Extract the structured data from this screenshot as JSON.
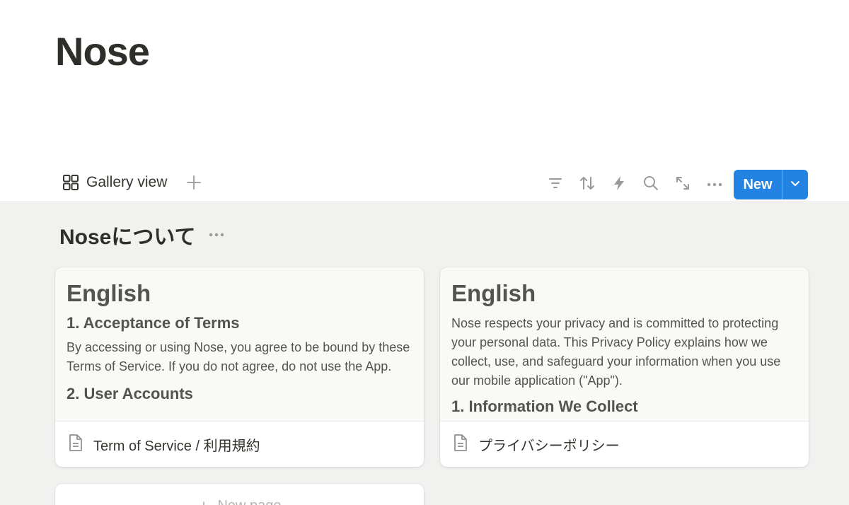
{
  "page": {
    "title": "Nose"
  },
  "toolbar": {
    "view_label": "Gallery view",
    "icons": [
      "gallery-icon",
      "plus-icon",
      "filter-icon",
      "sort-icon",
      "automation-icon",
      "search-icon",
      "expand-icon",
      "more-icon",
      "chevron-down-icon"
    ],
    "new_label": "New",
    "accent": "#2383e2"
  },
  "group": {
    "title": "Noseについて"
  },
  "cards": [
    {
      "preview_heading": "English",
      "preview_subheading": "1. Acceptance of Terms",
      "preview_text": "By accessing or using Nose, you agree to be bound by these Terms of Service. If you do not agree, do not use the App.",
      "preview_subheading2": "2. User Accounts",
      "name": "Term of Service / 利用規約"
    },
    {
      "preview_heading": "English",
      "preview_text": "Nose respects your privacy and is committed to protecting your personal data. This Privacy Policy explains how we collect, use, and safeguard your information when you use our mobile application (\"App\").",
      "preview_subheading": "1. Information We Collect",
      "name": "プライバシーポリシー"
    }
  ],
  "new_page": {
    "label": "New page"
  },
  "colors": {
    "gallery_bg": "#f1f1ef",
    "text": "#37352f"
  }
}
